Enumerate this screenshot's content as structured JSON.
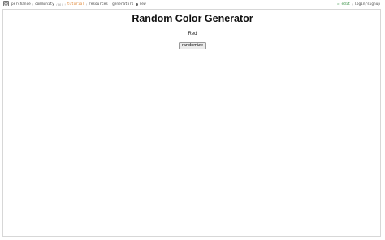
{
  "topbar": {
    "brand": "perchance",
    "links": [
      {
        "label": "community"
      },
      {
        "label": "tutorial"
      },
      {
        "label": "resources"
      },
      {
        "label": "generators"
      },
      {
        "label": "new"
      }
    ],
    "community_count": "(36)",
    "edit_label": "✏ edit",
    "account_label": "login/signup"
  },
  "page": {
    "title": "Random Color Generator",
    "result": "Red",
    "button_label": "randomize"
  },
  "icons": {
    "logo": "perchance-logo-icon",
    "new": "lightbulb-icon"
  },
  "colors": {
    "tutorial": "#e08a3c",
    "edit": "#2e8b3c"
  }
}
